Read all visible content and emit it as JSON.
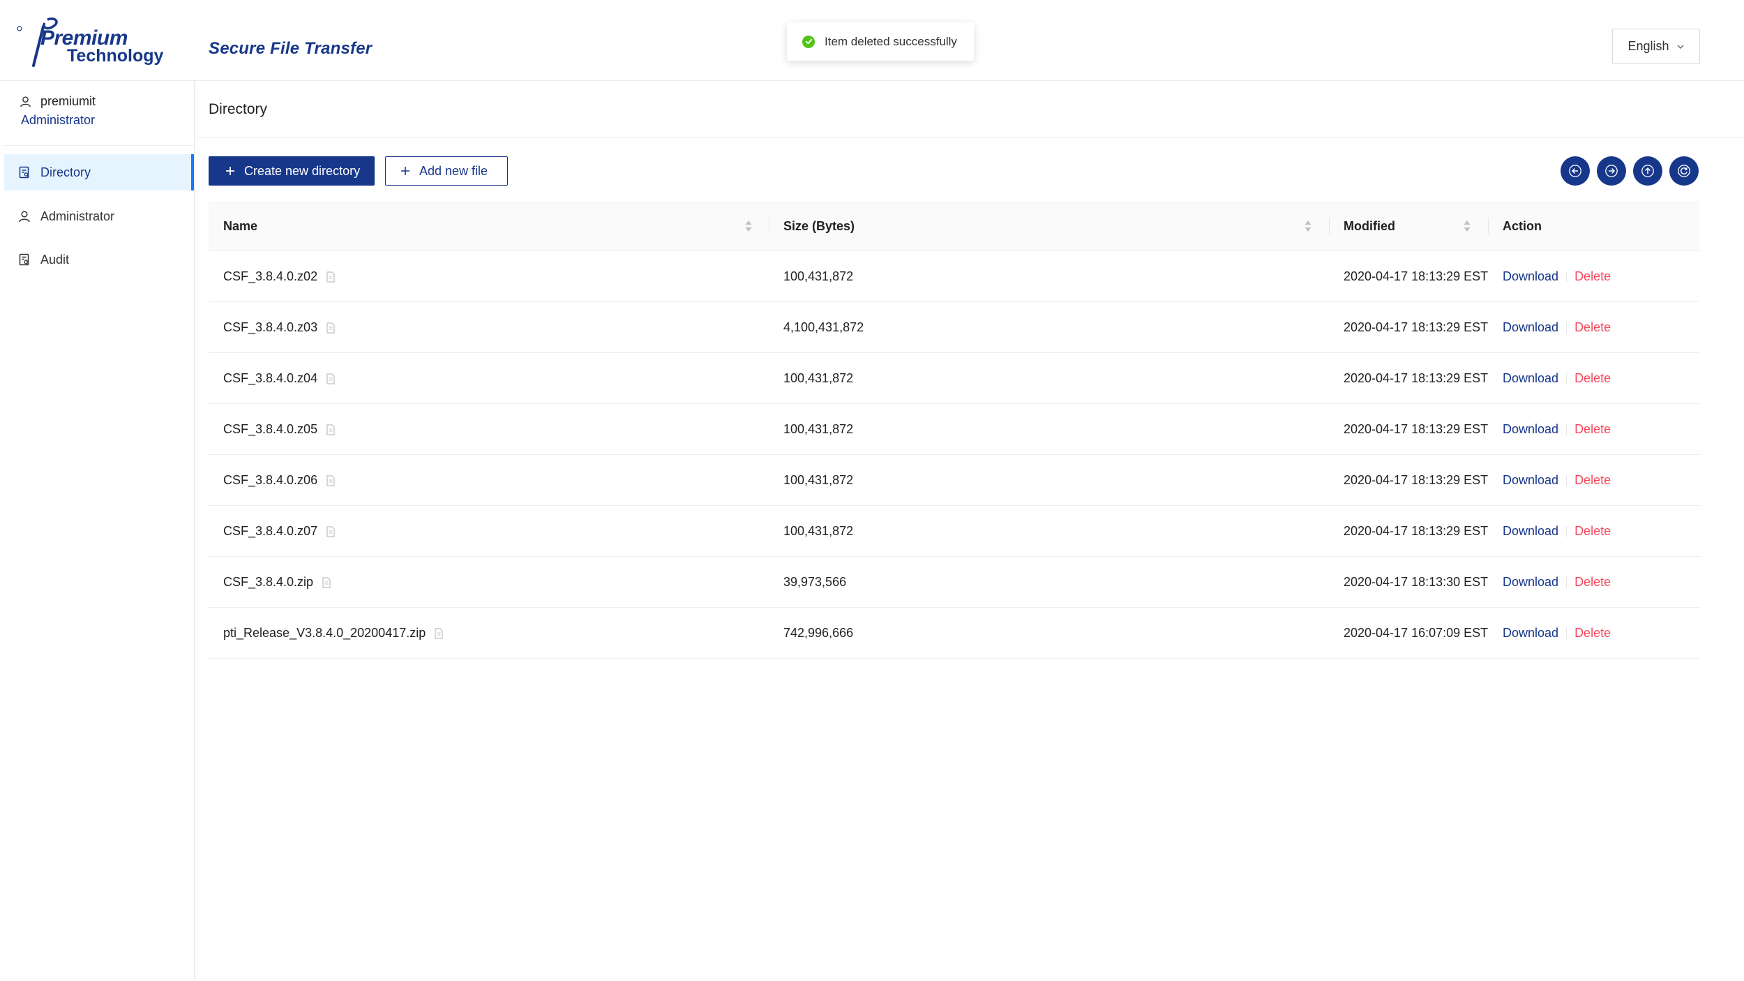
{
  "brand": {
    "logo_line1": "Premium",
    "logo_line2": "Technology",
    "logo_mark": "®",
    "app_title": "Secure File Transfer"
  },
  "toast": {
    "message": "Item deleted successfully",
    "icon": "check-circle-icon",
    "color": "#52c41a"
  },
  "language": {
    "selected": "English"
  },
  "user": {
    "name": "premiumit",
    "role": "Administrator"
  },
  "nav": {
    "items": [
      {
        "label": "Directory",
        "icon": "directory-icon",
        "active": true
      },
      {
        "label": "Administrator",
        "icon": "user-icon",
        "active": false
      },
      {
        "label": "Audit",
        "icon": "audit-icon",
        "active": false
      }
    ]
  },
  "page": {
    "title": "Directory"
  },
  "toolbar": {
    "create_directory_label": "Create new directory",
    "add_file_label": "Add new file"
  },
  "table": {
    "columns": {
      "name": "Name",
      "size": "Size (Bytes)",
      "modified": "Modified",
      "action": "Action"
    },
    "download_label": "Download",
    "delete_label": "Delete",
    "rows": [
      {
        "name": "CSF_3.8.4.0.z02",
        "size": "100,431,872",
        "modified": "2020-04-17 18:13:29 EST",
        "download": "Download",
        "delete": "Delete"
      },
      {
        "name": "CSF_3.8.4.0.z03",
        "size": "4,100,431,872",
        "modified": "2020-04-17 18:13:29 EST",
        "download": "Download",
        "delete": "Delete"
      },
      {
        "name": "CSF_3.8.4.0.z04",
        "size": "100,431,872",
        "modified": "2020-04-17 18:13:29 EST",
        "download": "Download",
        "delete": "Delete"
      },
      {
        "name": "CSF_3.8.4.0.z05",
        "size": "100,431,872",
        "modified": "2020-04-17 18:13:29 EST",
        "download": "Download",
        "delete": "Delete"
      },
      {
        "name": "CSF_3.8.4.0.z06",
        "size": "100,431,872",
        "modified": "2020-04-17 18:13:29 EST",
        "download": "Download",
        "delete": "Delete"
      },
      {
        "name": "CSF_3.8.4.0.z07",
        "size": "100,431,872",
        "modified": "2020-04-17 18:13:29 EST",
        "download": "Download",
        "delete": "Delete"
      },
      {
        "name": "CSF_3.8.4.0.zip",
        "size": "39,973,566",
        "modified": "2020-04-17 18:13:30 EST",
        "download": "Download",
        "delete": "Delete"
      },
      {
        "name": "pti_Release_V3.8.4.0_20200417.zip",
        "size": "742,996,666",
        "modified": "2020-04-17 16:07:09 EST",
        "download": "Download",
        "delete": "Delete"
      }
    ]
  },
  "colors": {
    "brand_navy": "#17378a",
    "active_nav_bg": "#e6f4ff",
    "active_nav_bar": "#1677ff",
    "delete_red": "#f5475b"
  }
}
